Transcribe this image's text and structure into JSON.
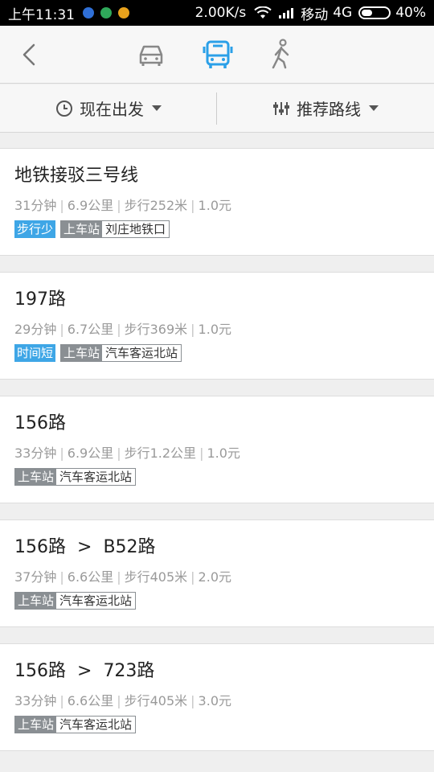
{
  "status_bar": {
    "time": "上午11:31",
    "net_speed": "2.00K/s",
    "carrier": "移动",
    "network": "4G",
    "battery": "40%",
    "battery_level": 0.4
  },
  "nav": {
    "active_mode": "bus"
  },
  "filters": {
    "depart": "现在出发",
    "sort": "推荐路线"
  },
  "routes": [
    {
      "title": [
        "地铁接驳三号线"
      ],
      "time": "31分钟",
      "distance": "6.9公里",
      "walk": "步行252米",
      "fare": "1.0元",
      "highlight": "步行少",
      "board_label": "上车站",
      "station": "刘庄地铁口"
    },
    {
      "title": [
        "197路"
      ],
      "time": "29分钟",
      "distance": "6.7公里",
      "walk": "步行369米",
      "fare": "1.0元",
      "highlight": "时间短",
      "board_label": "上车站",
      "station": "汽车客运北站"
    },
    {
      "title": [
        "156路"
      ],
      "time": "33分钟",
      "distance": "6.9公里",
      "walk": "步行1.2公里",
      "fare": "1.0元",
      "highlight": "",
      "board_label": "上车站",
      "station": "汽车客运北站"
    },
    {
      "title": [
        "156路",
        "B52路"
      ],
      "time": "37分钟",
      "distance": "6.6公里",
      "walk": "步行405米",
      "fare": "2.0元",
      "highlight": "",
      "board_label": "上车站",
      "station": "汽车客运北站"
    },
    {
      "title": [
        "156路",
        "723路"
      ],
      "time": "33分钟",
      "distance": "6.6公里",
      "walk": "步行405米",
      "fare": "3.0元",
      "highlight": "",
      "board_label": "上车站",
      "station": "汽车客运北站"
    }
  ],
  "title_separator": ">",
  "colors": {
    "accent": "#2ba0e8",
    "highlight_tag": "#3ea6e6",
    "board_tag": "#8a8f93"
  }
}
